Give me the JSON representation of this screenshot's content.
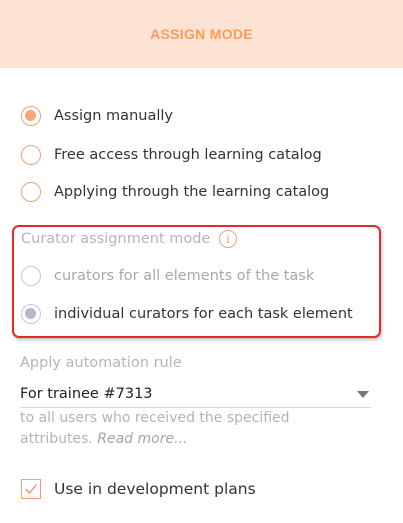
{
  "header": {
    "title": "ASSIGN MODE"
  },
  "assign_options": [
    {
      "label": "Assign manually",
      "checked": true
    },
    {
      "label": "Free access through learning catalog",
      "checked": false
    },
    {
      "label": "Applying through the learning catalog",
      "checked": false
    }
  ],
  "curator": {
    "title": "Curator assignment mode",
    "info_icon": "i",
    "options": [
      {
        "label": "curators for all elements of the task",
        "checked": false
      },
      {
        "label": "individual curators for each task element",
        "checked": true
      }
    ]
  },
  "automation": {
    "title": "Apply automation rule",
    "selected_value": "For trainee #7313",
    "hint": "to all users who received the specified attributes.",
    "read_more": "Read more..."
  },
  "development": {
    "label": "Use in development plans",
    "checked": true
  },
  "colors": {
    "accent": "#f3a077",
    "header_bg": "#fde3d4",
    "highlight_border": "#e22b2b"
  }
}
